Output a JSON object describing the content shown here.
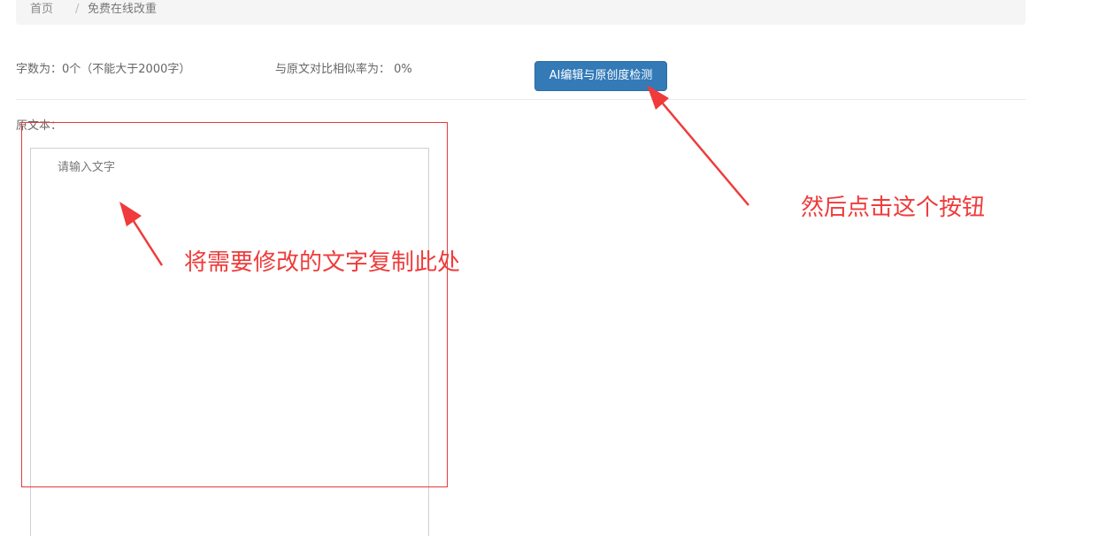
{
  "breadcrumb": {
    "home": "首页",
    "separator": "/",
    "current": "免费在线改重"
  },
  "stats": {
    "count_text": "字数为：0个（不能大于2000字）",
    "similarity_text": "与原文对比相似率为： 0%"
  },
  "toolbar": {
    "detect_button_label": "AI编辑与原创度检测"
  },
  "editor": {
    "label": "原文本：",
    "placeholder": "请输入文字",
    "value": ""
  },
  "annotations": {
    "left_note": "将需要修改的文字复制此处",
    "right_note": "然后点击这个按钮",
    "color": "#ef3b3b"
  },
  "colors": {
    "primary_button": "#337ab7",
    "breadcrumb_bg": "#f5f5f5"
  }
}
